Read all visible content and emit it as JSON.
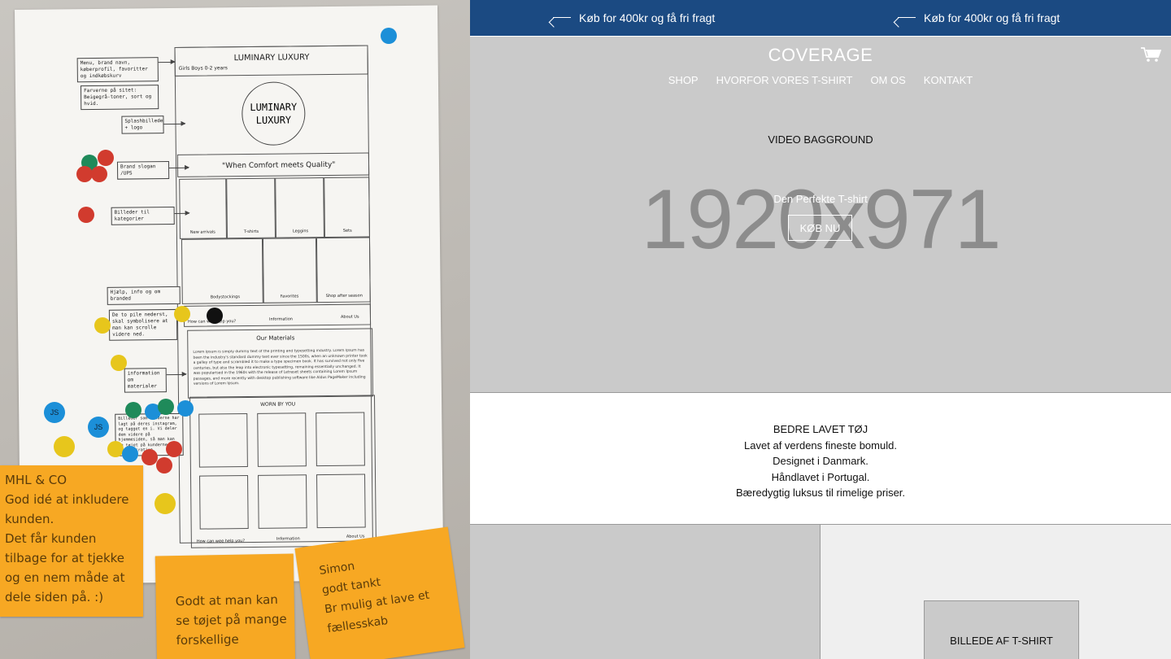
{
  "photo": {
    "wireframe": {
      "title": "LUMINARY LUXURY",
      "subnav": "Girls  Boys  0-2 years",
      "logo_line1": "LUMINARY",
      "logo_line2": "LUXURY",
      "slogan": "\"When Comfort meets Quality\"",
      "categories_row1": [
        "New arrivals",
        "T-shirts",
        "Leggins",
        "Sets"
      ],
      "categories_row2": [
        "Bodystockings",
        "Favorites",
        "Shop after season"
      ],
      "help_row": [
        "How can wee help you?",
        "Information",
        "About Us"
      ],
      "materials_title": "Our Materials",
      "materials_text": "Lorem Ipsum is simply dummy text of the printing and typesetting industry. Lorem Ipsum has been the industry's standard dummy text ever since the 1500s, when an unknown printer took a galley of type and scrambled it to make a type specimen book. It has survived not only five centuries, but also the leap into electronic typesetting, remaining essentially unchanged. It was popularised in the 1960s with the release of Letraset sheets containing Lorem Ipsum passages, and more recently with desktop publishing software like Aldus PageMaker including versions of Lorem Ipsum.",
      "worn_by_you": "WORN BY YOU",
      "footer_row": [
        "How can wee help you?",
        "Information",
        "About Us"
      ]
    },
    "notes": [
      "Menu, brand navn, køberprofil, favoritter og indkøbskurv",
      "Farverne på sitet: Beigegrå-toner, sort og hvid.",
      "Splashbillede + logo",
      "Brand slogan /UPS",
      "Billeder til kategorier",
      "Hjælp, info og om branded",
      "De to pile nederst, skal symbolisere at man kan scrolle videre ned.",
      "information om materialer",
      "Billeder som kunderne har lagt på deres instagram, og tagget en i. Vi deler dem videre på hjemmesiden, så man kan se tøjet på kunderne. og få inspiration."
    ],
    "stickies": [
      "MHL & CO\nGod idé at inkludere kunden.\nDet får kunden tilbage for at tjekke og en nem måde at dele siden på. :)",
      "Godt at man kan se tøjet på mange forskellige",
      "Simon\ngodt tankt\nBr mulig at lave et fællesskab"
    ],
    "dot_labels": [
      "JS",
      "JS"
    ]
  },
  "site": {
    "promo": [
      "Køb for 400kr og få fri fragt",
      "Køb for 400kr og få fri fragt"
    ],
    "brand": "COVERAGE",
    "nav": [
      "SHOP",
      "HVORFOR VORES T-SHIRT",
      "OM OS",
      "KONTAKT"
    ],
    "video_label": "VIDEO BAGGROUND",
    "dimension": "1920x971",
    "hero_sub": "Den Perfekte T-shirt",
    "buy_button": "KØB NU",
    "info_title": "BEDRE LAVET TØJ",
    "info_lines": [
      "Lavet af verdens fineste bomuld.",
      "Designet i Danmark.",
      "Håndlavet i Portugal.",
      "Bæredygtig luksus til rimelige priser."
    ],
    "tshirt_placeholder": "BILLEDE AF T-SHIRT",
    "colors": {
      "topbar": "#1b4a82",
      "hero_bg": "#cacaca",
      "placeholder_text": "#8c8c8c",
      "sticky": "#f7a823"
    },
    "icons": [
      "arrow-left-icon",
      "cart-icon"
    ]
  }
}
